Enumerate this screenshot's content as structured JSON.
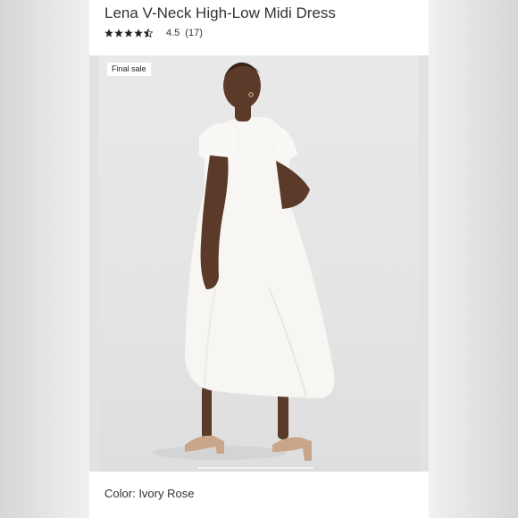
{
  "product": {
    "title": "Lena V-Neck High-Low Midi Dress",
    "rating": {
      "value": "4.5",
      "count": "(17)",
      "stars": 4.5,
      "max_stars": 5
    }
  },
  "image": {
    "badge": "Final sale"
  },
  "color": {
    "label": "Color:",
    "value": "Ivory Rose"
  },
  "colors": {
    "text": "#333333",
    "star": "#222222",
    "dress": "#f7f6f2",
    "skin": "#5b3a29",
    "backdrop": "#e6e6e6"
  }
}
